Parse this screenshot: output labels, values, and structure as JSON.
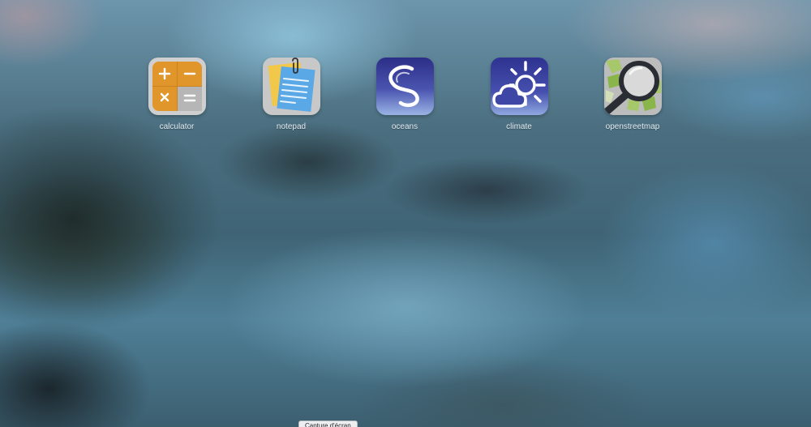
{
  "launcher": {
    "apps": [
      {
        "label": "calculator",
        "icon": "calculator-icon"
      },
      {
        "label": "notepad",
        "icon": "notepad-icon"
      },
      {
        "label": "oceans",
        "icon": "oceans-icon"
      },
      {
        "label": "climate",
        "icon": "climate-icon"
      },
      {
        "label": "openstreetmap",
        "icon": "openstreetmap-icon"
      }
    ]
  },
  "tooltip": {
    "text": "Capture d'écran"
  },
  "colors": {
    "calculator_orange": "#e0962a",
    "calculator_grey": "#b6b6b6",
    "notepad_blue": "#5aa9e6",
    "notepad_yellow": "#f2c84b",
    "oceans_blue": "#33368e",
    "climate_blue": "#3a3f9e",
    "osm_green": "#8ab54a"
  }
}
